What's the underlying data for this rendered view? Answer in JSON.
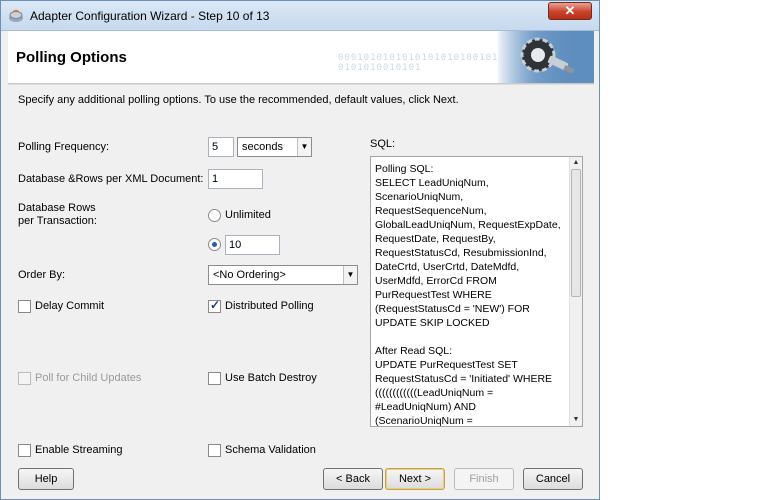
{
  "window": {
    "title": "Adapter Configuration Wizard - Step 10 of 13",
    "close": "✕"
  },
  "header": {
    "title": "Polling Options",
    "binary": "0001010101010101010100101010\n0101010010101"
  },
  "instructions": "Specify any additional polling options.  To use the recommended, default values, click Next.",
  "form": {
    "polling_frequency": {
      "label": "Polling Frequency:",
      "value": "5",
      "unit": "seconds"
    },
    "db_rows_per_xml": {
      "label": "Database &Rows per XML Document:",
      "value": "1"
    },
    "db_rows_per_txn": {
      "label_line1": "Database Rows",
      "label_line2": "per Transaction:",
      "unlimited_label": "Unlimited",
      "value": "10"
    },
    "order_by": {
      "label": "Order By:",
      "value": "<No Ordering>"
    },
    "delay_commit": {
      "label": "Delay Commit",
      "checked": false
    },
    "distributed_polling": {
      "label": "Distributed Polling",
      "checked": true
    },
    "poll_child_updates": {
      "label": "Poll for Child Updates",
      "checked": false,
      "enabled": false
    },
    "use_batch_destroy": {
      "label": "Use Batch Destroy",
      "checked": false
    },
    "enable_streaming": {
      "label": "Enable Streaming",
      "checked": false
    },
    "schema_validation": {
      "label": "Schema Validation",
      "checked": false
    }
  },
  "sql": {
    "label": "SQL:",
    "text": "Polling SQL:\nSELECT LeadUniqNum,\nScenarioUniqNum,\nRequestSequenceNum,\nGlobalLeadUniqNum, RequestExpDate,\nRequestDate, RequestBy,\nRequestStatusCd, ResubmissionInd,\nDateCrtd, UserCrtd, DateMdfd,\nUserMdfd, ErrorCd FROM\nPurRequestTest WHERE\n(RequestStatusCd = 'NEW') FOR\nUPDATE SKIP LOCKED\n\nAfter Read SQL:\nUPDATE PurRequestTest SET\nRequestStatusCd = 'Initiated' WHERE\n((((((((((((LeadUniqNum =\n#LeadUniqNum) AND\n(ScenarioUniqNum ="
  },
  "buttons": {
    "help": "Help",
    "back": "< Back",
    "next": "Next >",
    "finish": "Finish",
    "cancel": "Cancel"
  },
  "icons": [
    "app-icon",
    "close-icon",
    "gear-plug-icon",
    "chevron-down-icon",
    "scroll-up-icon",
    "scroll-down-icon"
  ]
}
